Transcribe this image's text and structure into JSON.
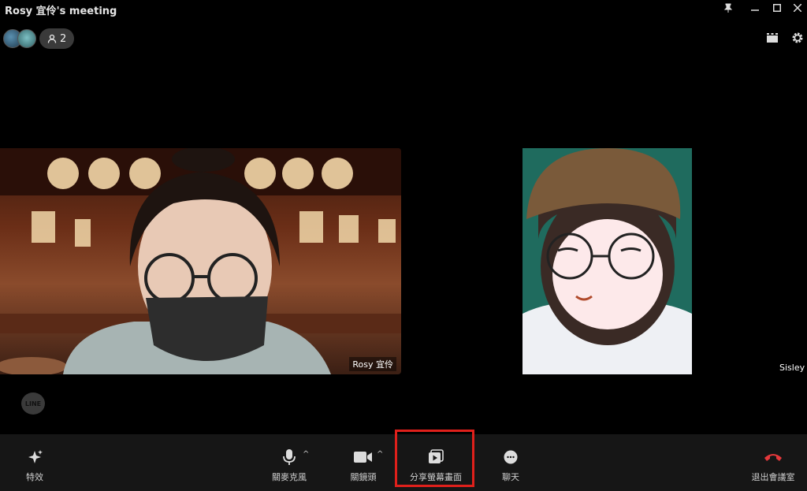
{
  "window": {
    "title": "Rosy 宜伶's meeting"
  },
  "participants": {
    "count": "2"
  },
  "videos": [
    {
      "name": "Rosy 宜伶"
    },
    {
      "name": "Sisley"
    }
  ],
  "logo": {
    "text": "LINE"
  },
  "toolbar": {
    "effects": "特效",
    "mute_mic": "關麥克風",
    "camera_off": "關鏡頭",
    "share_screen": "分享螢幕畫面",
    "chat": "聊天",
    "leave": "退出會議室"
  },
  "colors": {
    "leave_red": "#e5383b",
    "highlight_red": "#e0201b"
  }
}
